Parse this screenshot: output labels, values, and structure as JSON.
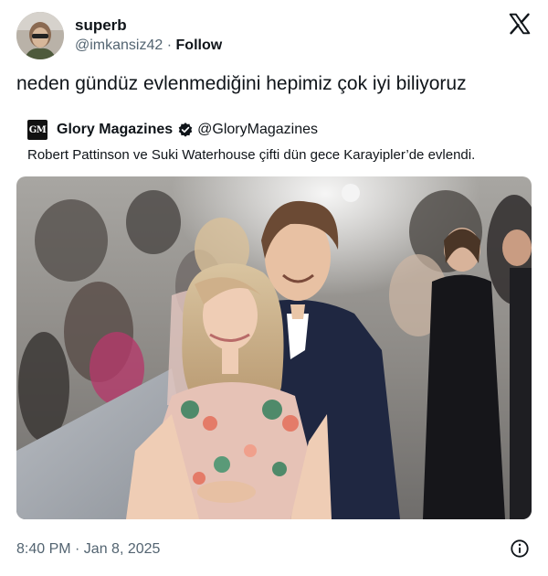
{
  "user": {
    "name": "superb",
    "handle": "@imkansiz42",
    "separator": "·",
    "follow_label": "Follow",
    "avatar_icon": "user-avatar"
  },
  "brand": {
    "logo_icon": "x-logo-icon"
  },
  "tweet": {
    "text": "neden gündüz evlenmediğini hepimiz çok iyi biliyoruz",
    "timestamp": "8:40 PM · Jan 8, 2025"
  },
  "quote": {
    "logo_text": "GM",
    "name": "Glory Magazines",
    "verified_icon": "verified-badge-icon",
    "handle": "@GloryMagazines",
    "text": "Robert Pattinson ve Suki Waterhouse çifti dün gece Karayipler’de evlendi."
  },
  "colors": {
    "text_primary": "#0f1419",
    "text_secondary": "#536471",
    "verified_badge": "#0f1419"
  }
}
